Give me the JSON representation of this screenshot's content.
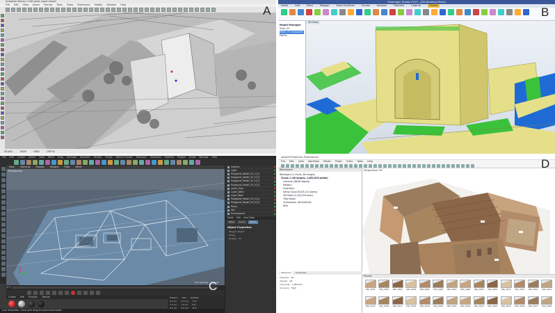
{
  "panels": {
    "a": {
      "letter": "A",
      "title": "Autodesk ReCap / CAD point cloud viewer",
      "menu": [
        "File",
        "Edit",
        "View",
        "Insert",
        "Format",
        "Tools",
        "Draw",
        "Dimension",
        "Modify",
        "Window",
        "Help"
      ],
      "status": [
        "MODEL",
        "SNAP",
        "GRID",
        "ORTHO"
      ]
    },
    "b": {
      "letter": "B",
      "title": "Geomagic Studio 2013 - [3D Building Mesh]",
      "menu": [
        "Home",
        "Edit",
        "Point",
        "Polygon",
        "Exact Surfaces",
        "Curves",
        "Analysis",
        "Features",
        "Capture",
        "Display"
      ],
      "active_menu_index": 9,
      "tree_title": "Model Manager",
      "tree_items": [
        "Scan_01",
        "Mesh_01 [cropped]",
        "Points"
      ],
      "tree_selected_index": 1,
      "view_tab": "3D View"
    },
    "c": {
      "letter": "C",
      "menu": [
        "File",
        "Edit",
        "Create",
        "Select",
        "Tools",
        "Mesh",
        "Snap",
        "Animate",
        "Simulate",
        "Render",
        "Sculpt",
        "Motion Tracker",
        "MoGraph",
        "Character",
        "Pipeline",
        "Plugins",
        "Script",
        "Window",
        "Help"
      ],
      "viewport_menu": [
        "View",
        "Cameras",
        "Display",
        "Options",
        "Filter",
        "Panel"
      ],
      "viewport_label": "Perspective",
      "objects": [
        "Camera",
        "Light",
        "Polygonal_Model_Tri_1 [2]",
        "Polygonal_Model_Tri_2 [2]",
        "Polygonal_Model_Tri_3 [2]",
        "Polygonal_Model_Tri_4 [2]",
        "Layer_Floor",
        "Layer_Walls",
        "Layer_Roof",
        "Polygonal_Model_Tri_5 [2]",
        "Polygonal_Model_Tri_6 [2]",
        "Plane",
        "Sky",
        "Environment"
      ],
      "attr_head": [
        "Mode",
        "Edit",
        "User Data"
      ],
      "attr_tabs": [
        "Basic",
        "Coord.",
        "Object"
      ],
      "attr_active_index": 2,
      "props_title": "Object Properties",
      "props": [
        [
          "Polygon Object",
          ""
        ],
        [
          "Phong",
          ""
        ],
        [
          "Display",
          "On"
        ]
      ],
      "grid_label": "Grid Spacing : 1000 cm",
      "frame_label": "0 F",
      "mat_menu": [
        "Create",
        "Edit",
        "Function",
        "Texture"
      ],
      "materials": [
        "Mat",
        "Mat.1",
        "Mat.2",
        "Mat.3"
      ],
      "coords": [
        [
          "Position",
          "Size",
          "Rotation"
        ],
        [
          "X 0 cm",
          "X 0 cm",
          "H 0°"
        ],
        [
          "Y 0 cm",
          "Y 0 cm",
          "P 0°"
        ],
        [
          "Z 0 cm",
          "Z 0 cm",
          "B 0°"
        ]
      ],
      "status": "Live Selection: Click and drag to select elements."
    },
    "d": {
      "letter": "D",
      "title": "Agisoft PhotoScan Professional",
      "menu": [
        "File",
        "Edit",
        "View",
        "Workflow",
        "Model",
        "Photo",
        "Ortho",
        "Tools",
        "Help"
      ],
      "workspace_title": "Workspace",
      "tree": [
        "Workspace (1 chunk, 48 images)",
        "Chunk 1 (48 images, 1,482,615 points)",
        "Cameras (48/48 aligned)",
        "Markers",
        "Scale Bars",
        "Dense Cloud (8,425,112 points)",
        "3D Model (1,204,578 faces)",
        "Tiled Model",
        "Orthomosaic (8192x6144)",
        "DEM"
      ],
      "tree_bold_index": 1,
      "bottom_tabs": [
        "Reference",
        "Properties"
      ],
      "bottom_active_index": 0,
      "props": [
        [
          "Cameras",
          "48"
        ],
        [
          "Aligned",
          "48"
        ],
        [
          "Tie points",
          "1,482,615"
        ],
        [
          "Accuracy",
          "High"
        ]
      ],
      "view_label": "Perspective 30°",
      "photos_label": "Photos",
      "photos": [
        "IMG_0001",
        "IMG_0002",
        "IMG_0003",
        "IMG_0004",
        "IMG_0005",
        "IMG_0006",
        "IMG_0007",
        "IMG_0008",
        "IMG_0009",
        "IMG_0010",
        "IMG_0011",
        "IMG_0012",
        "IMG_0013",
        "IMG_0014",
        "IMG_0015",
        "IMG_0016",
        "IMG_0017",
        "IMG_0018",
        "IMG_0019",
        "IMG_0020",
        "IMG_0021",
        "IMG_0022",
        "IMG_0023",
        "IMG_0024",
        "IMG_0025",
        "IMG_0026",
        "IMG_0027",
        "IMG_0028"
      ]
    }
  },
  "colors": {
    "mesh_yellow": "#e6df8a",
    "deviation_green": "#3ac23a",
    "deviation_blue": "#1e6bd6",
    "c4d_blue": "#7aa7cf",
    "roof_tan": "#b38b6a"
  }
}
